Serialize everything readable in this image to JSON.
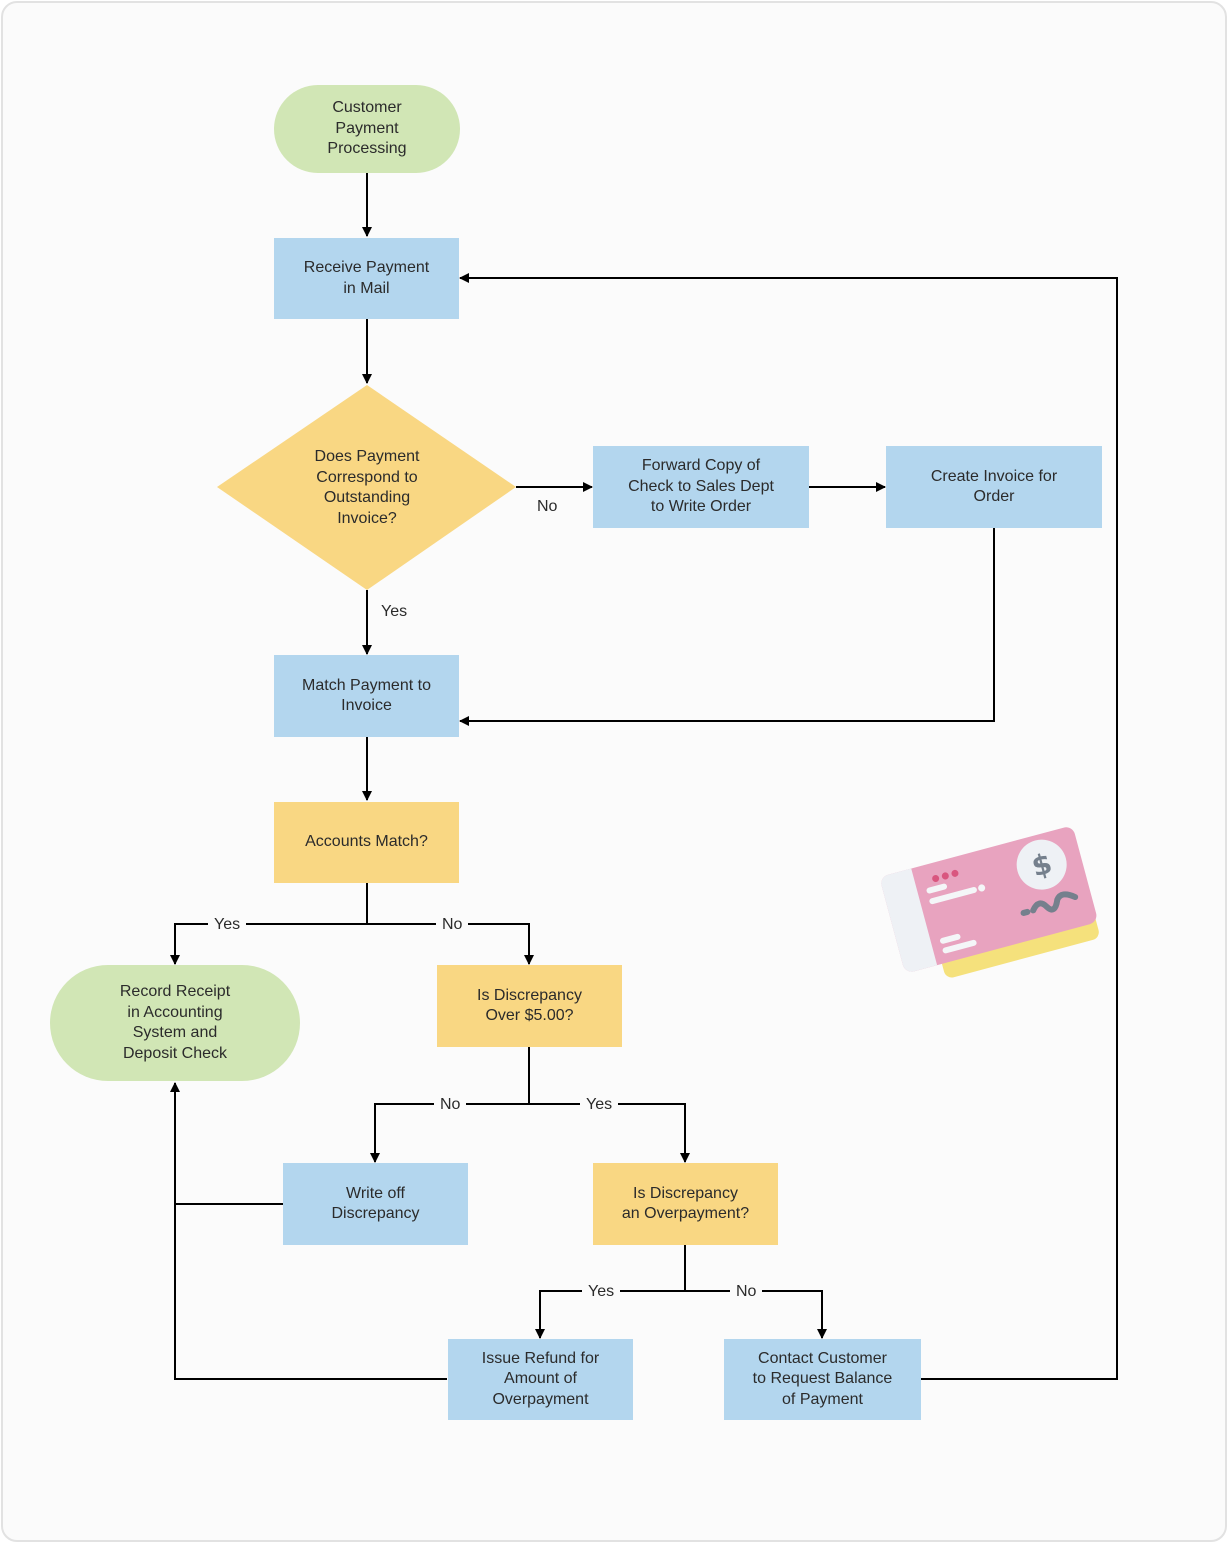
{
  "diagram": {
    "title": "Customer Payment Processing",
    "colors": {
      "process": "#b3d6ee",
      "decision": "#f9d783",
      "terminal": "#d1e6b5",
      "connector": "#000000"
    },
    "nodes": {
      "start": {
        "type": "terminal",
        "text": "Customer\nPayment\nProcessing"
      },
      "receive": {
        "type": "process",
        "text": "Receive Payment\nin Mail"
      },
      "correspond": {
        "type": "decision",
        "text": "Does Payment\nCorrespond to\nOutstanding\nInvoice?"
      },
      "forward": {
        "type": "process",
        "text": "Forward Copy of\nCheck to Sales Dept\nto Write Order"
      },
      "create_invoice": {
        "type": "process",
        "text": "Create Invoice for\nOrder"
      },
      "match": {
        "type": "process",
        "text": "Match Payment to\nInvoice"
      },
      "accounts_match": {
        "type": "decision",
        "text": "Accounts Match?"
      },
      "record": {
        "type": "terminal",
        "text": "Record Receipt\nin Accounting\nSystem and\nDeposit Check"
      },
      "over5": {
        "type": "decision",
        "text": "Is Discrepancy\nOver $5.00?"
      },
      "write_off": {
        "type": "process",
        "text": "Write off\nDiscrepancy"
      },
      "overpayment": {
        "type": "decision",
        "text": "Is Discrepancy\nan Overpayment?"
      },
      "refund": {
        "type": "process",
        "text": "Issue Refund for\nAmount of\nOverpayment"
      },
      "contact": {
        "type": "process",
        "text": "Contact Customer\nto Request Balance\nof Payment"
      }
    },
    "edge_labels": {
      "correspond_no": "No",
      "correspond_yes": "Yes",
      "accounts_yes": "Yes",
      "accounts_no": "No",
      "over5_no": "No",
      "over5_yes": "Yes",
      "overpay_yes": "Yes",
      "overpay_no": "No"
    },
    "edges": [
      {
        "from": "start",
        "to": "receive"
      },
      {
        "from": "receive",
        "to": "correspond"
      },
      {
        "from": "correspond",
        "to": "forward",
        "label": "No"
      },
      {
        "from": "forward",
        "to": "create_invoice"
      },
      {
        "from": "create_invoice",
        "to": "match"
      },
      {
        "from": "correspond",
        "to": "match",
        "label": "Yes"
      },
      {
        "from": "match",
        "to": "accounts_match"
      },
      {
        "from": "accounts_match",
        "to": "record",
        "label": "Yes"
      },
      {
        "from": "accounts_match",
        "to": "over5",
        "label": "No"
      },
      {
        "from": "over5",
        "to": "write_off",
        "label": "No"
      },
      {
        "from": "over5",
        "to": "overpayment",
        "label": "Yes"
      },
      {
        "from": "write_off",
        "to": "record"
      },
      {
        "from": "overpayment",
        "to": "refund",
        "label": "Yes"
      },
      {
        "from": "overpayment",
        "to": "contact",
        "label": "No"
      },
      {
        "from": "refund",
        "to": "record"
      },
      {
        "from": "contact",
        "to": "receive"
      }
    ],
    "illustration": "check-payment-icon"
  }
}
